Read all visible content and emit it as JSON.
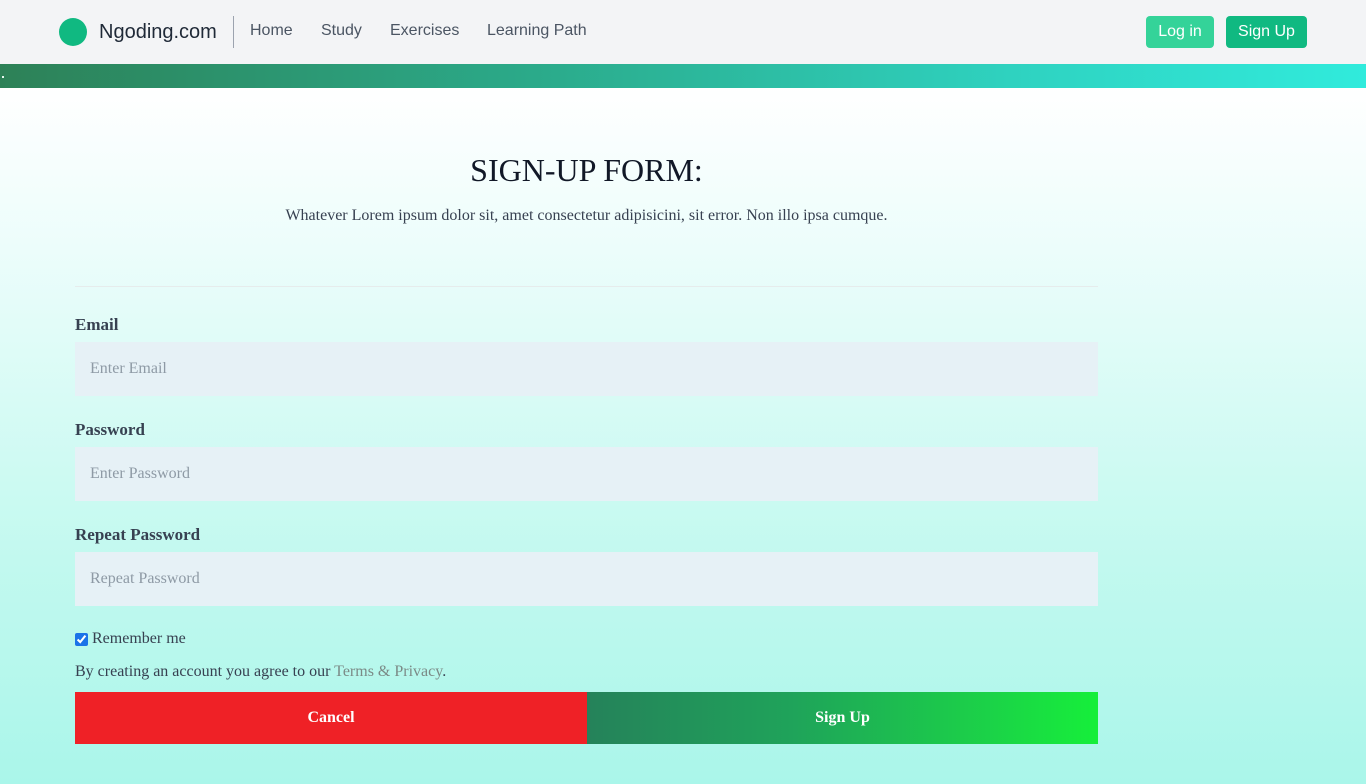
{
  "navbar": {
    "brand": "Ngoding.com",
    "links": [
      "Home",
      "Study",
      "Exercises",
      "Learning Path"
    ],
    "login_label": "Log in",
    "signup_label": "Sign Up"
  },
  "form": {
    "title": "SIGN-UP FORM:",
    "subtitle": "Whatever Lorem ipsum dolor sit, amet consectetur adipisicini, sit error. Non illo ipsa cumque.",
    "email": {
      "label": "Email",
      "placeholder": "Enter Email",
      "value": ""
    },
    "password": {
      "label": "Password",
      "placeholder": "Enter Password",
      "value": ""
    },
    "repeat_password": {
      "label": "Repeat Password",
      "placeholder": "Repeat Password",
      "value": ""
    },
    "remember": {
      "label": "Remember me",
      "checked": true
    },
    "terms": {
      "prefix": "By creating an account you agree to our ",
      "link": "Terms & Privacy",
      "suffix": "."
    },
    "cancel_label": "Cancel",
    "submit_label": "Sign Up"
  },
  "colors": {
    "brand_green": "#10b981",
    "cancel_red": "#ef2126",
    "submit_green_start": "#25825a",
    "submit_green_end": "#16ef3a"
  },
  "icons": {
    "logo": "logo-circle-icon"
  }
}
